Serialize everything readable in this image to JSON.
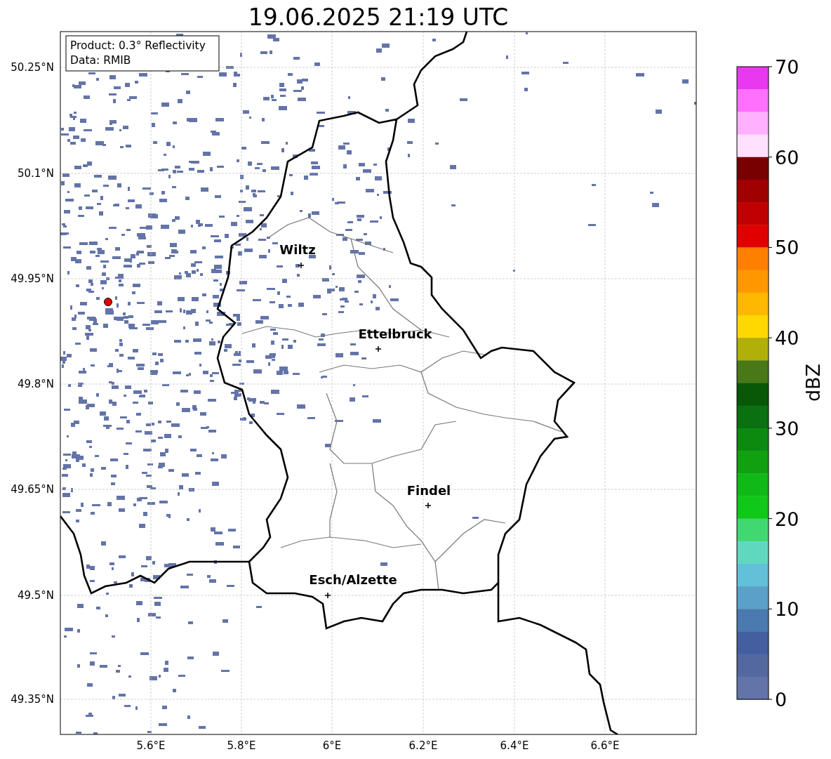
{
  "title": "19.06.2025 21:19 UTC",
  "info_box": [
    "Product: 0.3° Reflectivity",
    "Data: RMIB"
  ],
  "y_tick_labels": [
    "50.25°N",
    "50.1°N",
    "49.95°N",
    "49.8°N",
    "49.65°N",
    "49.5°N",
    "49.35°N"
  ],
  "x_tick_labels": [
    "5.6°E",
    "5.8°E",
    "6°E",
    "6.2°E",
    "6.4°E",
    "6.6°E"
  ],
  "places": [
    "Wiltz",
    "Ettelbruck",
    "Findel",
    "Esch/Alzette"
  ],
  "colorbar": {
    "label": "dBZ",
    "tick_labels": [
      "70",
      "60",
      "50",
      "40",
      "30",
      "20",
      "10",
      "0"
    ],
    "bands": [
      {
        "color": "#e838f0"
      },
      {
        "color": "#ff70ff"
      },
      {
        "color": "#ffb0ff"
      },
      {
        "color": "#ffe0ff"
      },
      {
        "color": "#780000"
      },
      {
        "color": "#a00000"
      },
      {
        "color": "#c00000"
      },
      {
        "color": "#e00000"
      },
      {
        "color": "#ff8000"
      },
      {
        "color": "#ff9800"
      },
      {
        "color": "#ffb800"
      },
      {
        "color": "#ffd800"
      },
      {
        "color": "#b0b008"
      },
      {
        "color": "#487818"
      },
      {
        "color": "#085808"
      },
      {
        "color": "#0a7010"
      },
      {
        "color": "#0c8a10"
      },
      {
        "color": "#10a010"
      },
      {
        "color": "#10b818"
      },
      {
        "color": "#10c818"
      },
      {
        "color": "#40d870"
      },
      {
        "color": "#60d8c0"
      },
      {
        "color": "#62c0d8"
      },
      {
        "color": "#5aa0c8"
      },
      {
        "color": "#4a7ab0"
      },
      {
        "color": "#435fa0"
      },
      {
        "color": "#5468a0"
      },
      {
        "color": "#6374a8"
      }
    ]
  }
}
